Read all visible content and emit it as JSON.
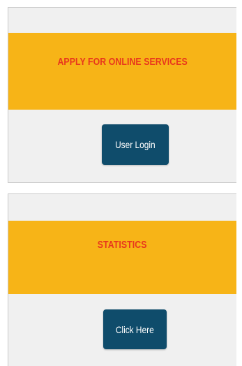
{
  "services": {
    "title": "APPLY FOR ONLINE SERVICES",
    "button_label": "User Login"
  },
  "statistics": {
    "title": "STATISTICS",
    "button_label": "Click Here"
  },
  "colors": {
    "banner": "#f7b417",
    "title_text": "#e8361d",
    "button": "#0f4c6b",
    "panel": "#f0f0f0"
  }
}
